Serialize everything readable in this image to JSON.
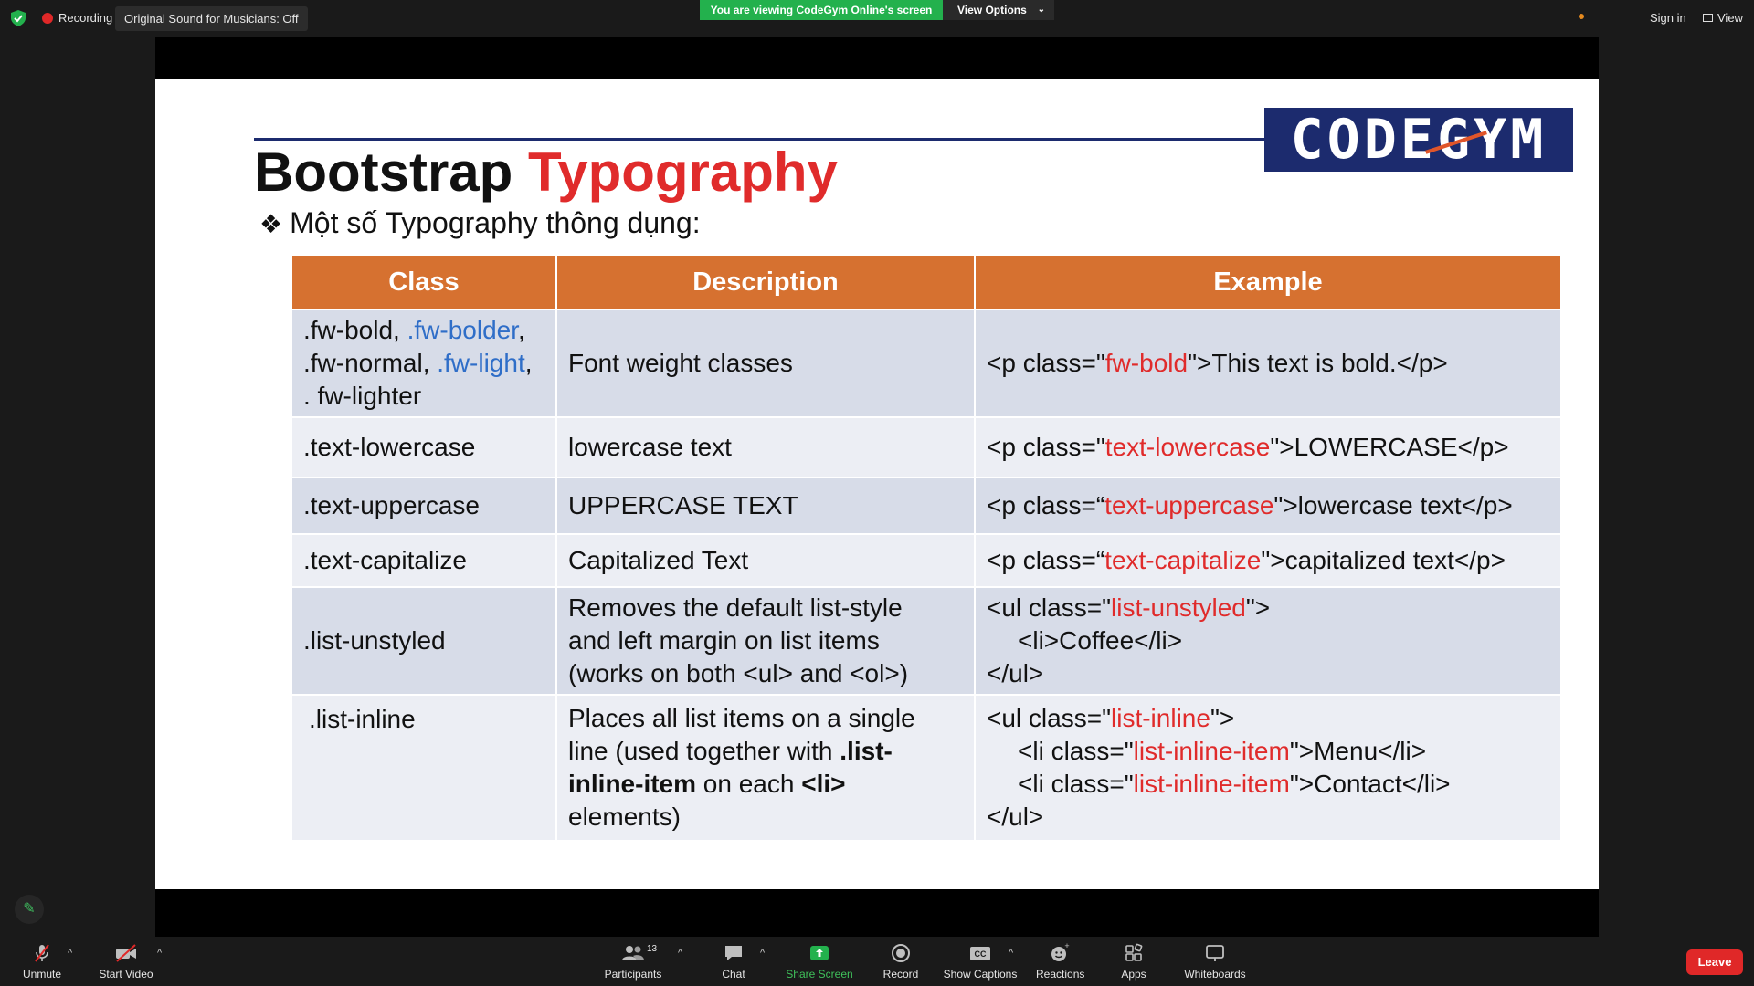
{
  "topbar": {
    "recording_label": "Recording",
    "original_sound_label": "Original Sound for Musicians: Off",
    "viewing_banner": "You are viewing CodeGym Online's screen",
    "view_options_label": "View Options",
    "sign_in_label": "Sign in",
    "view_label": "View"
  },
  "slide": {
    "logo_text": "CODEGYM",
    "title_part1": "Bootstrap",
    "title_part2": "Typography",
    "subtitle": "Một số Typography thông dụng:",
    "headers": {
      "c1": "Class",
      "c2": "Description",
      "c3": "Example"
    },
    "rows": {
      "r0": {
        "class_l1a": ".fw-bold, ",
        "class_l1b": ".fw-bolder",
        "class_l1c": ",",
        "class_l2a": ".fw-normal, ",
        "class_l2b": ".fw-light",
        "class_l2c": ",",
        "class_l3": ". fw-lighter",
        "desc": "Font weight classes",
        "ex_a": "<p class=\"",
        "ex_b": "fw-bold",
        "ex_c": "\">This text is bold.</p>"
      },
      "r1": {
        "class": ".text-lowercase",
        "desc": "lowercase text",
        "ex_a": "<p class=\"",
        "ex_b": "text-lowercase",
        "ex_c": "\">LOWERCASE</p>"
      },
      "r2": {
        "class": ".text-uppercase",
        "desc": "UPPERCASE TEXT",
        "ex_a": "<p class=“",
        "ex_b": "text-uppercase",
        "ex_c": "\">lowercase text</p>"
      },
      "r3": {
        "class": ".text-capitalize",
        "desc": "Capitalized Text",
        "ex_a": "<p class=“",
        "ex_b": "text-capitalize",
        "ex_c": "\">capitalized text</p>"
      },
      "r4": {
        "class": ".list-unstyled",
        "desc_l1": "Removes the default list-style",
        "desc_l2": "and left margin on list items",
        "desc_l3": "(works on both <ul> and <ol>)",
        "ex_l1a": "<ul class=\"",
        "ex_l1b": "list-unstyled",
        "ex_l1c": "\">",
        "ex_l2": "<li>Coffee</li>",
        "ex_l3": "</ul>"
      },
      "r5": {
        "class": ".list-inline",
        "desc_l1": "Places all list items on a single",
        "desc_l2a": "line (used together with ",
        "desc_l2b": ".list-",
        "desc_l3a": "inline-item",
        "desc_l3b": " on each ",
        "desc_l3c": "<li>",
        "desc_l4": "elements)",
        "ex_l1a": "<ul class=\"",
        "ex_l1b": "list-inline",
        "ex_l1c": "\">",
        "ex_l2a": "<li class=\"",
        "ex_l2b": "list-inline-item",
        "ex_l2c": "\">Menu</li>",
        "ex_l3a": "<li class=\"",
        "ex_l3b": "list-inline-item",
        "ex_l3c": "\">Contact</li>",
        "ex_l4": "</ul>"
      }
    }
  },
  "toolbar": {
    "unmute": "Unmute",
    "start_video": "Start Video",
    "participants": "Participants",
    "participants_count": "13",
    "chat": "Chat",
    "share_screen": "Share Screen",
    "record": "Record",
    "show_captions": "Show Captions",
    "captions_icon_text": "CC",
    "reactions": "Reactions",
    "apps": "Apps",
    "whiteboards": "Whiteboards",
    "leave": "Leave"
  },
  "colors": {
    "banner_green": "#23b14d",
    "header_orange": "#d67130",
    "accent_red": "#e02b2b",
    "link_blue": "#2f6ec8",
    "logo_navy": "#1c2b6e",
    "leave_red": "#e02828"
  }
}
